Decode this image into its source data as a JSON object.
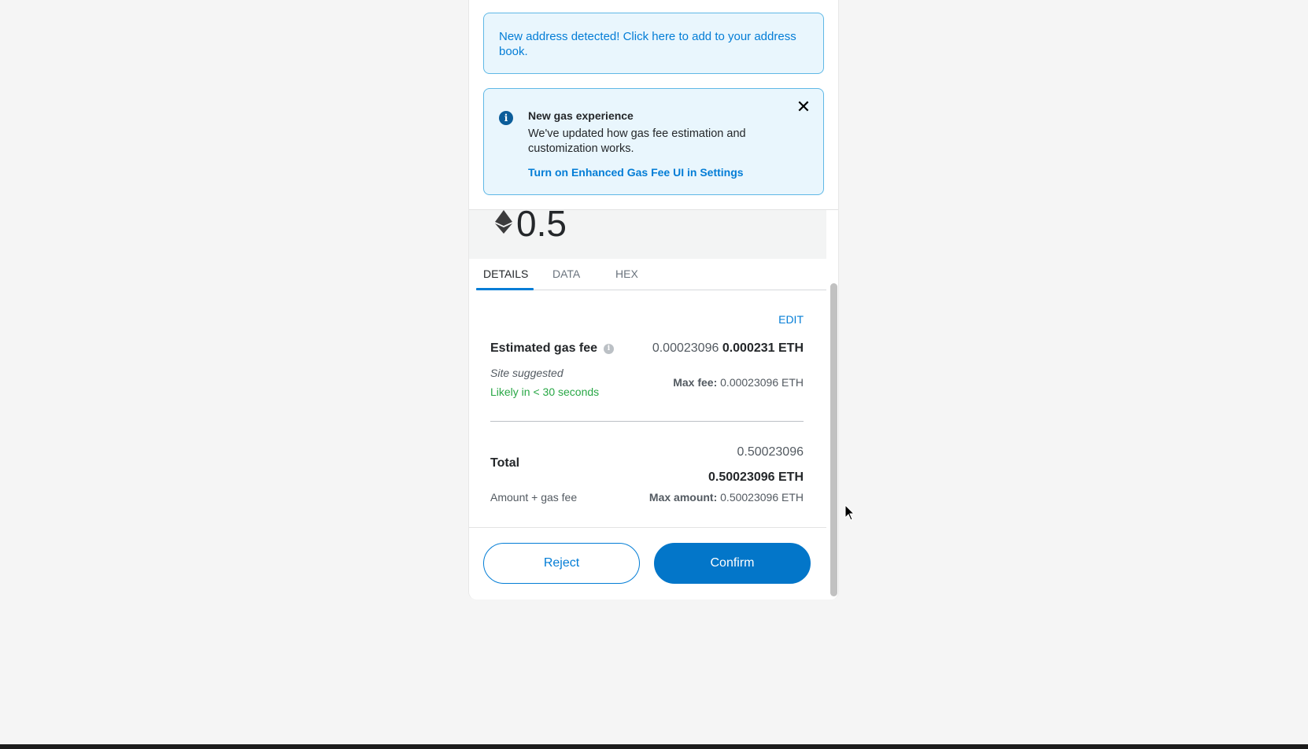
{
  "address_notice": {
    "text": "New address detected! Click here to add to your address book."
  },
  "gas_notice": {
    "title": "New gas experience",
    "body": "We've updated how gas fee estimation and customization works.",
    "link": "Turn on Enhanced Gas Fee UI in Settings",
    "info_icon": "i",
    "close_icon": "✕"
  },
  "amount": {
    "value": "0.5",
    "icon": "eth-diamond"
  },
  "tabs": [
    {
      "label": "DETAILS",
      "active": true
    },
    {
      "label": "DATA",
      "active": false
    },
    {
      "label": "HEX",
      "active": false
    }
  ],
  "details": {
    "edit_label": "EDIT",
    "gas_fee_label": "Estimated gas fee",
    "gas_fee_secondary": "0.00023096",
    "gas_fee_primary": "0.000231 ETH",
    "site_suggested": "Site suggested",
    "likely": "Likely in < 30 seconds",
    "max_fee_label": "Max fee:",
    "max_fee_value": "0.00023096 ETH",
    "total_label": "Total",
    "total_secondary": "0.50023096",
    "total_primary": "0.50023096 ETH",
    "amount_gas_label": "Amount + gas fee",
    "max_amount_label": "Max amount:",
    "max_amount_value": "0.50023096 ETH"
  },
  "buttons": {
    "reject": "Reject",
    "confirm": "Confirm"
  },
  "colors": {
    "accent": "#037dd6",
    "confirm_bg": "#0376c9",
    "notice_bg": "#e9f6fd",
    "notice_border": "#5fb8e6",
    "success": "#28a745"
  }
}
